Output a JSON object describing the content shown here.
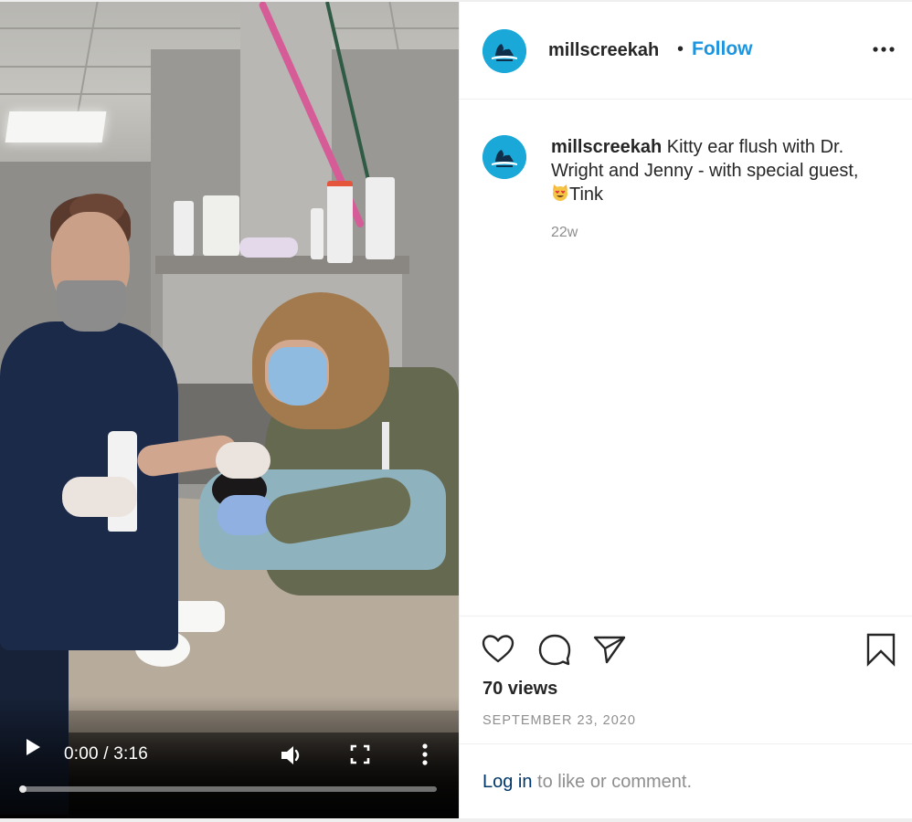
{
  "post": {
    "account": {
      "username": "millscreekah",
      "avatar_icon": "millscreek-logo-icon",
      "brand_color": "#1aa8d8"
    },
    "header": {
      "separator": "•",
      "follow_label": "Follow",
      "follow_color": "#1b95e0",
      "options_icon": "more-horizontal-icon"
    },
    "caption": {
      "username": "millscreekah",
      "text_part1": " Kitty ear flush with Dr. Wright and Jenny - with special guest, ",
      "emoji": "😻",
      "text_part2": "Tink",
      "time_ago": "22w"
    },
    "actions": {
      "like_icon": "heart-icon",
      "comment_icon": "comment-icon",
      "share_icon": "paper-plane-icon",
      "save_icon": "bookmark-icon",
      "views": "70 views",
      "date": "SEPTEMBER 23, 2020"
    },
    "login_prompt": {
      "link_label": "Log in",
      "rest": " to like or comment."
    }
  },
  "video": {
    "current_time": "0:00",
    "duration": "3:16",
    "time_display": "0:00 / 3:16",
    "progress_fraction": 0,
    "controls": {
      "play_icon": "play-icon",
      "volume_icon": "volume-icon",
      "fullscreen_icon": "fullscreen-icon",
      "more_icon": "more-vertical-icon"
    },
    "scene_description": "Two masked veterinary staff flushing a black cat's ear on an exam table"
  }
}
